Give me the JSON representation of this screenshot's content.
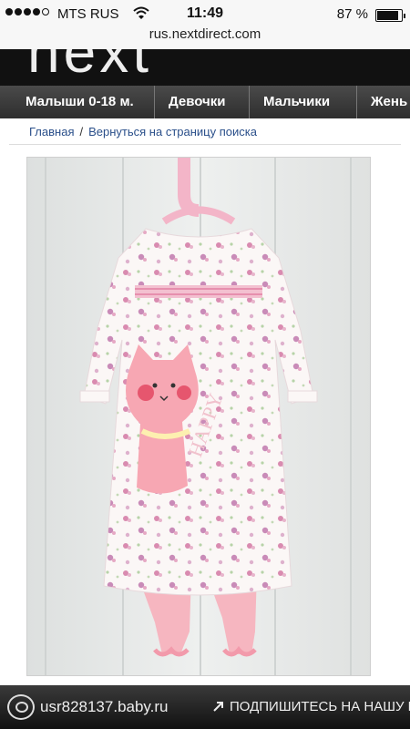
{
  "status_bar": {
    "carrier": "MTS RUS",
    "time": "11:49",
    "battery": "87 %",
    "battery_level": 0.87,
    "signal_icon": "signal-dots-icon",
    "wifi_icon": "wifi-icon"
  },
  "browser": {
    "url": "rus.nextdirect.com"
  },
  "site": {
    "logo_text": "next",
    "nav": [
      {
        "label": "Малыши 0-18 м."
      },
      {
        "label": "Девочки"
      },
      {
        "label": "Мальчики"
      },
      {
        "label": "Жень"
      }
    ],
    "breadcrumb": {
      "home": "Главная",
      "separator": "/",
      "back": "Вернуться на страницу поиска"
    }
  },
  "product": {
    "image_icon": "baby-outfit-photo",
    "applique_text": "HAPPY"
  },
  "app_bar": {
    "username": "usr828137.baby.ru",
    "subscribe": "ПОДПИШИТЕСЬ НА НАШУ Р",
    "logo_icon": "babyru-logo-icon",
    "arrow_icon": "arrow-up-right-icon"
  },
  "colors": {
    "nav_bg": "#3a3a3a",
    "link": "#2a4f8a",
    "header_bg": "#111111",
    "pink": "#f3a7b8"
  }
}
